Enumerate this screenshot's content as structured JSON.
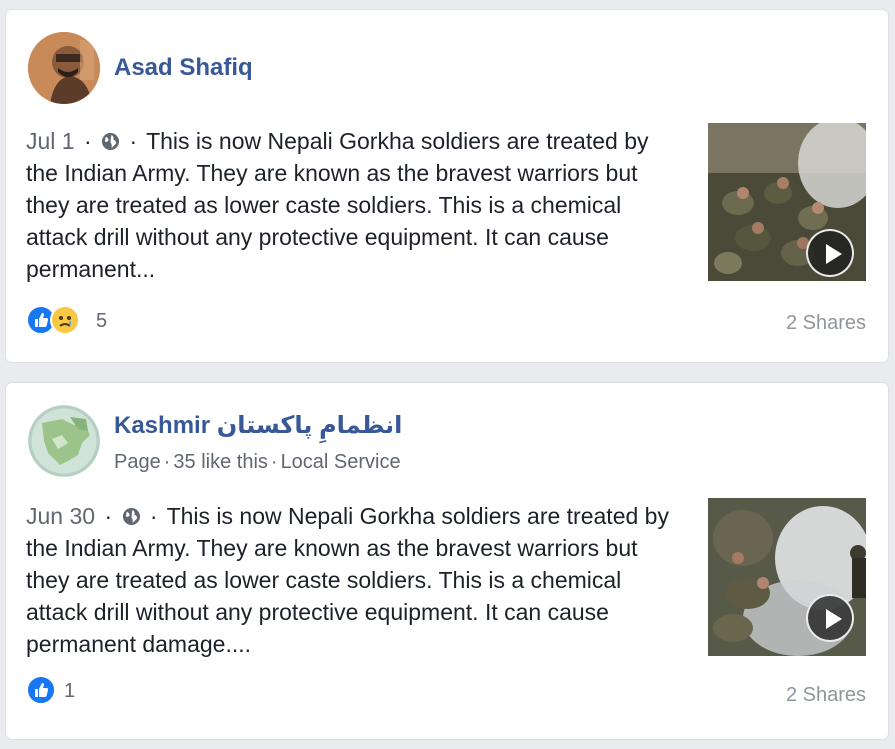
{
  "posts": [
    {
      "author": "Asad Shafiq",
      "date": "Jul 1",
      "separator": "·",
      "text": "This is now Nepali Gorkha soldiers are treated by the Indian Army. They are known as the bravest warriors but they are treated as lower caste soldiers. This is a chemical attack drill without any protective equipment. It can cause permanent...",
      "reaction_icons": [
        "like-icon",
        "sad-icon"
      ],
      "reaction_count": "5",
      "shares": "2 Shares"
    },
    {
      "author": "Kashmir انظمامِ پاکستان",
      "meta": {
        "type": "Page",
        "likes": "35 like this",
        "category": "Local Service"
      },
      "date": "Jun 30",
      "separator": "·",
      "text": "This is now Nepali Gorkha soldiers are treated by the Indian Army. They are known as the bravest warriors but they are treated as lower caste soldiers. This is a chemical attack drill without any protective equipment. It can cause permanent damage....",
      "reaction_icons": [
        "like-icon"
      ],
      "reaction_count": "1",
      "shares": "2 Shares"
    }
  ],
  "colors": {
    "author_link": "#385898",
    "like_blue": "#1877f2",
    "background": "#e9ebee"
  }
}
